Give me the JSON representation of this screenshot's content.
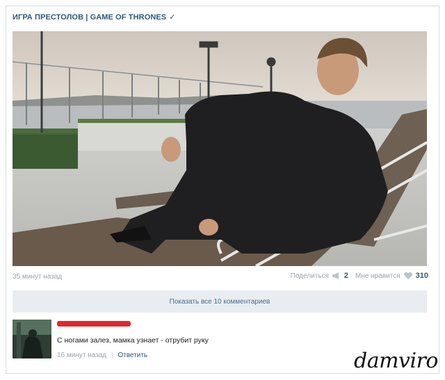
{
  "post": {
    "author": "ИГРА ПРЕСТОЛОВ | GAME OF THRONES",
    "verified_icon": "checkmark-icon",
    "image_alt": "",
    "time_ago": "35 минут назад",
    "share_label": "Поделиться",
    "share_count": "2",
    "like_label": "Мне нравится",
    "like_count": "310"
  },
  "comments_bar": {
    "label": "Показать все 10 комментариев"
  },
  "comment": {
    "text": "С ногами залез, мамка узнает - отрубит руку",
    "time_ago": "16 минут назад",
    "separator": "|",
    "reply_label": "Ответить"
  },
  "watermark": {
    "text": "damviro"
  },
  "colors": {
    "link": "#2b587a",
    "meta": "#9aa3ad",
    "bar": "#e9edf1",
    "redaction": "#e3262b"
  }
}
